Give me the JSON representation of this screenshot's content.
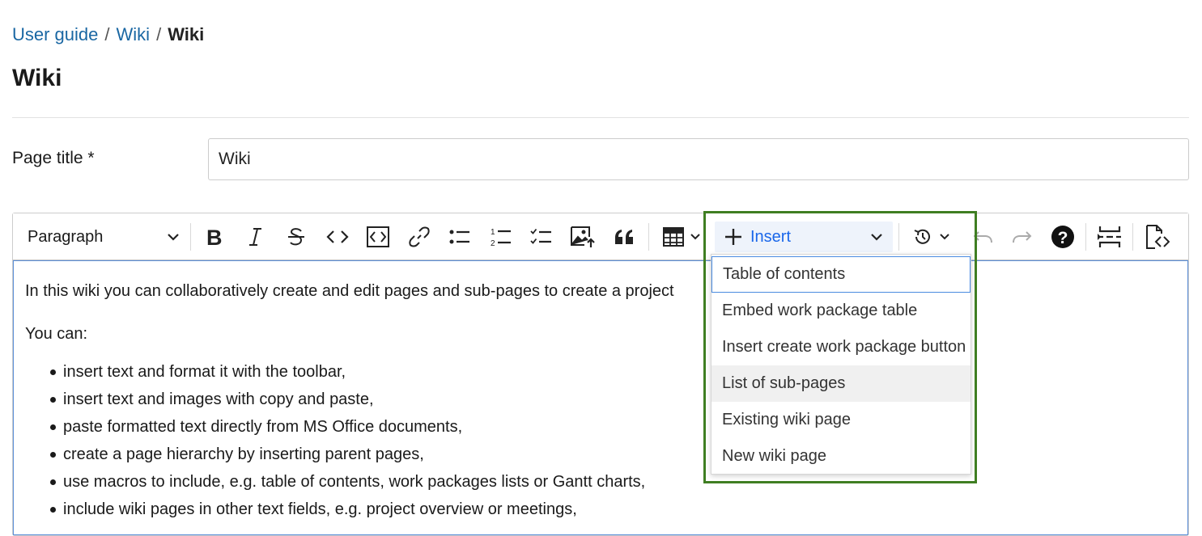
{
  "breadcrumb": {
    "items": [
      "User guide",
      "Wiki"
    ],
    "separator": "/",
    "current": "Wiki"
  },
  "page": {
    "title": "Wiki"
  },
  "form": {
    "title_label": "Page title *",
    "title_value": "Wiki"
  },
  "toolbar": {
    "paragraph_label": "Paragraph",
    "insert_label": "Insert",
    "icons": [
      "bold-icon",
      "italic-icon",
      "strikethrough-icon",
      "code-icon",
      "code-block-icon",
      "link-icon",
      "bulleted-list-icon",
      "numbered-list-icon",
      "todo-list-icon",
      "image-upload-icon",
      "blockquote-icon",
      "table-icon",
      "plus-icon",
      "history-icon",
      "undo-icon",
      "redo-icon",
      "help-icon",
      "page-break-icon",
      "source-icon"
    ]
  },
  "insert_menu": {
    "items": [
      "Table of contents",
      "Embed work package table",
      "Insert create work package button",
      "List of sub-pages",
      "Existing wiki page",
      "New wiki page"
    ],
    "focused_index": 0,
    "hovered_index": 3
  },
  "content": {
    "intro": "In this wiki you can collaboratively create and edit pages and sub-pages to create a project",
    "you_can": "You can:",
    "bullets": [
      "insert text and format it with the toolbar,",
      "insert text and images with copy and paste,",
      "paste formatted text directly from MS Office documents,",
      "create a page hierarchy by inserting parent pages,",
      "use macros to include, e.g. table of contents, work packages lists or Gantt charts,",
      "include wiki pages in other text fields, e.g. project overview or meetings,"
    ]
  },
  "colors": {
    "link": "#1a67a3",
    "insert_accent": "#1a67ea",
    "highlight": "#3f7e22",
    "focus": "#4a8be0"
  }
}
